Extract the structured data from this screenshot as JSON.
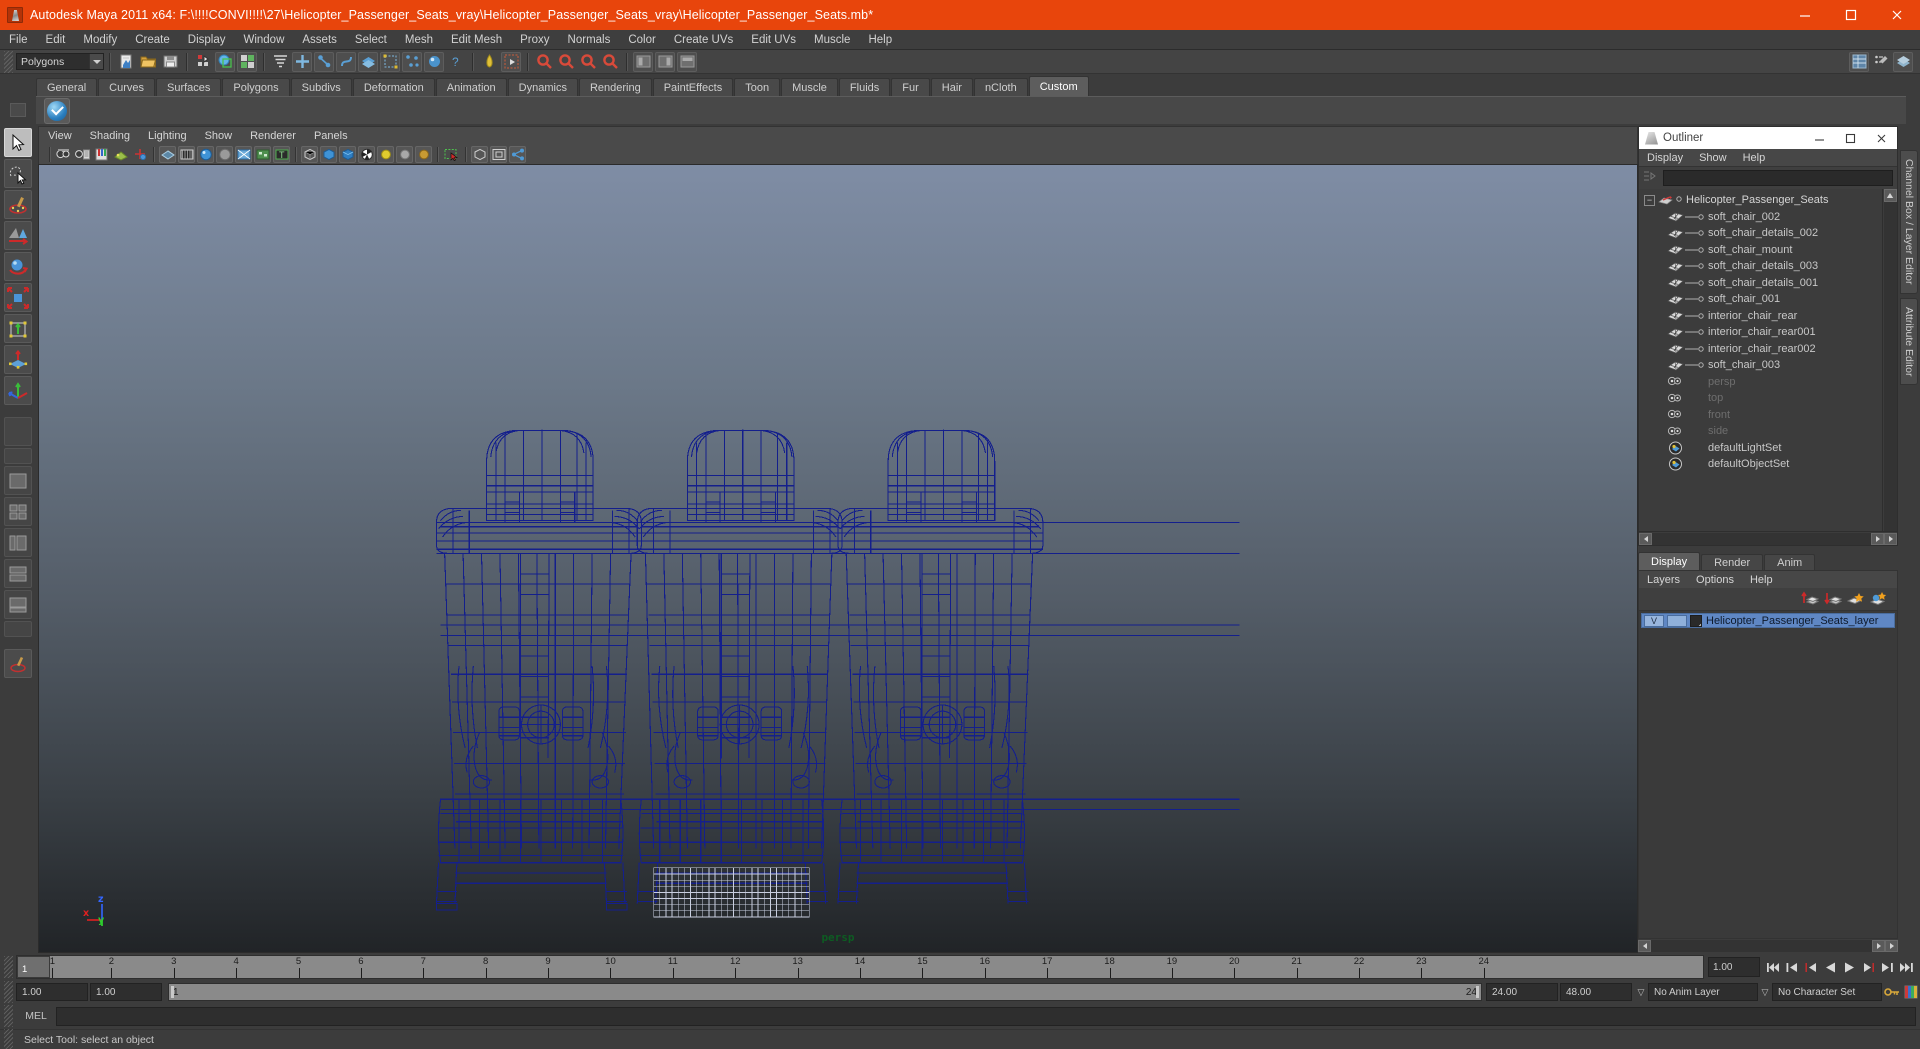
{
  "titlebar": {
    "app_title": "Autodesk Maya 2011 x64: F:\\!!!!CONVI!!!!\\27\\Helicopter_Passenger_Seats_vray\\Helicopter_Passenger_Seats_vray\\Helicopter_Passenger_Seats.mb*",
    "icon": "maya-logo-icon",
    "minimize": "—",
    "maximize": "□",
    "close": "✕",
    "bg_color": "#e8450c"
  },
  "menubar": {
    "items": [
      "File",
      "Edit",
      "Modify",
      "Create",
      "Display",
      "Window",
      "Assets",
      "Select",
      "Mesh",
      "Edit Mesh",
      "Proxy",
      "Normals",
      "Color",
      "Create UVs",
      "Edit UVs",
      "Muscle",
      "Help"
    ]
  },
  "statusbar": {
    "mode_menu": "Polygons"
  },
  "shelf": {
    "tabs": [
      "General",
      "Curves",
      "Surfaces",
      "Polygons",
      "Subdivs",
      "Deformation",
      "Animation",
      "Dynamics",
      "Rendering",
      "PaintEffects",
      "Toon",
      "Muscle",
      "Fluids",
      "Fur",
      "Hair",
      "nCloth",
      "Custom"
    ],
    "active_tab": "Custom"
  },
  "toolbox": {
    "tools": [
      "select-tool",
      "lasso-select-tool",
      "paint-select-tool",
      "move-tool-alt",
      "rotate-tool",
      "scale-tool",
      "universal-manipulator-tool",
      "soft-modification-tool",
      "show-manipulator-tool",
      "last-tool"
    ]
  },
  "viewport": {
    "panel_menus": [
      "View",
      "Shading",
      "Lighting",
      "Show",
      "Renderer",
      "Panels"
    ],
    "camera_label": "persp",
    "axis": {
      "x": "x",
      "y": "y",
      "z": "z"
    },
    "wireframe_color": "#141f8c",
    "bg_top": "#7f8da5",
    "bg_bottom": "#212427"
  },
  "outliner": {
    "title": "Outliner",
    "window_buttons": {
      "minimize": "—",
      "maximize": "□",
      "close": "✕"
    },
    "menus": [
      "Display",
      "Show",
      "Help"
    ],
    "search_value": "",
    "root": {
      "label": "Helicopter_Passenger_Seats",
      "expander": "−"
    },
    "children": [
      "soft_chair_002",
      "soft_chair_details_002",
      "soft_chair_mount",
      "soft_chair_details_003",
      "soft_chair_details_001",
      "soft_chair_001",
      "interior_chair_rear",
      "interior_chair_rear001",
      "interior_chair_rear002",
      "soft_chair_003"
    ],
    "cameras": [
      "persp",
      "top",
      "front",
      "side"
    ],
    "sets": [
      "defaultLightSet",
      "defaultObjectSet"
    ]
  },
  "layereditor": {
    "tabs": [
      "Display",
      "Render",
      "Anim"
    ],
    "active_tab": "Display",
    "menus": [
      "Layers",
      "Options",
      "Help"
    ],
    "toolbar_icons": [
      "move-layer-up-icon",
      "move-layer-down-icon",
      "new-layer-icon",
      "new-layer-from-selected-icon"
    ],
    "layers": [
      {
        "visibility": "V",
        "playback": "",
        "name": "Helicopter_Passenger_Seats_layer",
        "selected": true
      }
    ]
  },
  "side_tabs": [
    "Channel Box / Layer Editor",
    "Attribute Editor"
  ],
  "timeslider": {
    "ticks": [
      1,
      2,
      3,
      4,
      5,
      6,
      7,
      8,
      9,
      10,
      11,
      12,
      13,
      14,
      15,
      16,
      17,
      18,
      19,
      20,
      21,
      22,
      23,
      24
    ],
    "current_frame": "1",
    "current_field": "1.00",
    "playback_buttons": [
      "go-to-start-icon",
      "step-back-key-icon",
      "step-back-frame-icon",
      "play-backwards-icon",
      "play-forwards-icon",
      "step-forward-frame-icon",
      "step-forward-key-icon",
      "go-to-end-icon"
    ]
  },
  "rangeslider": {
    "anim_start": "1.00",
    "range_start": "1.00",
    "range_bar_start": "1",
    "range_bar_end": "24",
    "range_end": "24.00",
    "anim_end": "48.00",
    "anim_layer": "No Anim Layer",
    "character_set": "No Character Set",
    "caret": "▽"
  },
  "commandline": {
    "label": "MEL",
    "value": ""
  },
  "helpline": {
    "text": "Select Tool: select an object"
  }
}
